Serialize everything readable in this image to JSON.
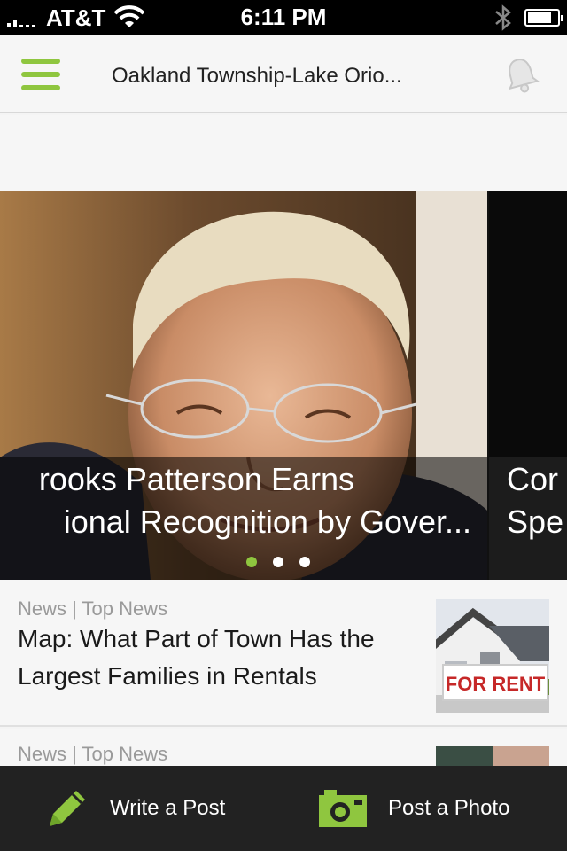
{
  "status_bar": {
    "carrier": "AT&T",
    "time": "6:11 PM"
  },
  "header": {
    "title": "Oakland Township-Lake Orio...",
    "menu_icon": "hamburger-menu-icon",
    "bell_icon": "bell-icon"
  },
  "carousel": {
    "slides": [
      {
        "line1": "rooks Patterson Earns",
        "line2": "ional Recognition by Gover..."
      },
      {
        "line1": "Cor",
        "line2": "Spe"
      }
    ],
    "dot_count": 3,
    "active_dot": 0
  },
  "articles": [
    {
      "category": "News | Top News",
      "title": "Map: What Part of Town Has the Largest Families in Rentals",
      "sign_text": "FOR RENT"
    },
    {
      "category": "News | Top News",
      "title": ""
    }
  ],
  "bottom_bar": {
    "write_label": "Write a Post",
    "photo_label": "Post a Photo"
  },
  "colors": {
    "accent": "#8fc63f",
    "bottom_bar": "#222222",
    "header_bg": "#f6f6f6"
  }
}
